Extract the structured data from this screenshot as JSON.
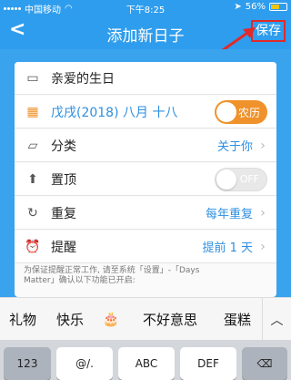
{
  "status_bar": {
    "carrier": "中国移动",
    "time": "下午8:25",
    "battery_percent": "56%",
    "battery_level": 0.56
  },
  "nav": {
    "back_icon": "chevron-left-icon",
    "title": "添加新日子",
    "save_label": "保存",
    "highlight_color": "#e02a2a"
  },
  "form": {
    "name_placeholder": "亲爱的生日",
    "date_value": "戊戌(2018) 八月 十八",
    "lunar_toggle_label": "农历",
    "lunar_toggle_on": true,
    "category_label": "分类",
    "category_value": "关于你",
    "pin_label": "置顶",
    "pin_toggle_label": "OFF",
    "pin_toggle_on": false,
    "repeat_label": "重复",
    "repeat_value": "每年重复",
    "reminder_label": "提醒",
    "reminder_value": "提前 1 天",
    "note_line1": "为保证提醒正常工作, 请至系统「设置」-「Days",
    "note_line2": "Matter」确认以下功能已开启:"
  },
  "keyboard": {
    "suggestions": [
      "礼物",
      "快乐",
      "🎂",
      "不好意思",
      "蛋糕"
    ],
    "suggestion_more_icon": "chevron-up-icon",
    "key_labels": [
      "123",
      "@/.",
      "ABC",
      "DEF",
      "⌫"
    ]
  },
  "colors": {
    "accent_blue": "#2f9ded",
    "toggle_orange": "#f0922b",
    "value_blue": "#2f8fe0"
  }
}
